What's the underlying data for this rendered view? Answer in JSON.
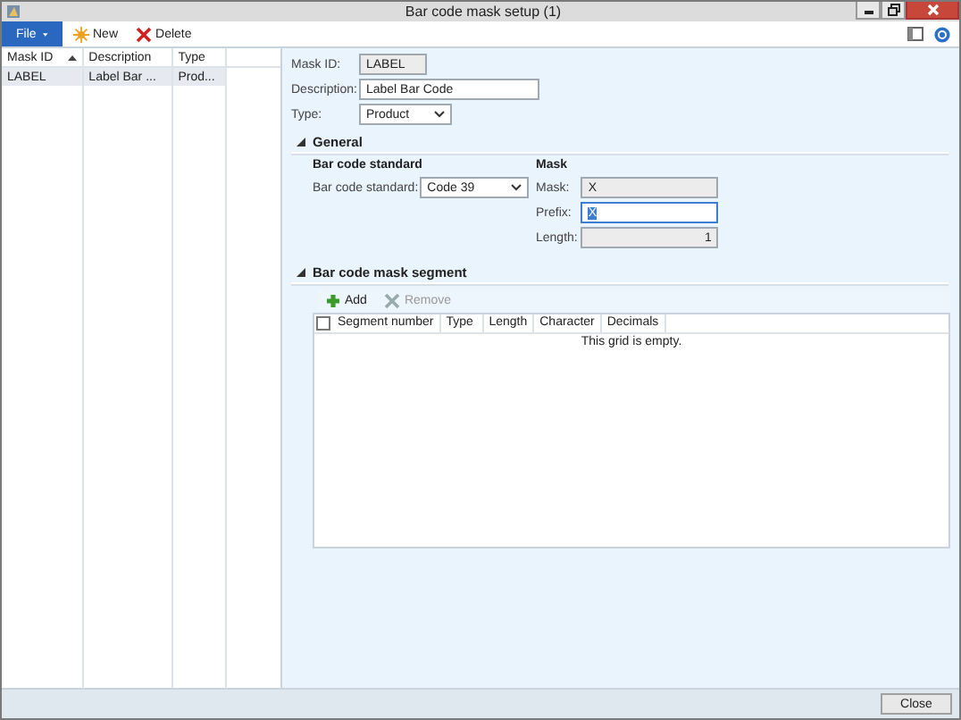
{
  "window": {
    "title": "Bar code mask setup (1)"
  },
  "toolbar": {
    "file_menu": "File",
    "buttons": [
      {
        "kind": "new",
        "label": "New"
      },
      {
        "kind": "delete",
        "label": "Delete"
      }
    ]
  },
  "list": {
    "columns": [
      {
        "label": "Mask ID",
        "sorted": true
      },
      {
        "label": "Description",
        "sorted": false
      },
      {
        "label": "Type",
        "sorted": false
      }
    ],
    "rows": [
      {
        "cells": [
          "LABEL",
          "Label Bar ...",
          "Prod..."
        ],
        "selected": true
      }
    ]
  },
  "header_fields": [
    {
      "label": "Mask ID:",
      "value": "LABEL",
      "kind": "readonly"
    },
    {
      "label": "Description:",
      "value": "Label Bar Code",
      "kind": "text"
    },
    {
      "label": "Type:",
      "value": "Product",
      "kind": "dropdown"
    }
  ],
  "general": {
    "title": "General",
    "expanded": true,
    "groups": [
      {
        "title": "Bar code standard",
        "fields": [
          {
            "label": "Bar code standard:",
            "value": "Code 39",
            "kind": "dropdown"
          }
        ]
      },
      {
        "title": "Mask",
        "fields": [
          {
            "label": "Mask:",
            "value": "X",
            "kind": "readonly"
          },
          {
            "label": "Prefix:",
            "value": "X",
            "kind": "focused"
          },
          {
            "label": "Length:",
            "value": "1",
            "kind": "number"
          }
        ]
      }
    ]
  },
  "segment": {
    "title": "Bar code mask segment",
    "expanded": true,
    "buttons": [
      {
        "kind": "add",
        "label": "Add",
        "disabled": false
      },
      {
        "kind": "remove",
        "label": "Remove",
        "disabled": true
      }
    ],
    "columns": [
      "Segment number",
      "Type",
      "Length",
      "Character",
      "Decimals"
    ],
    "select_all": false,
    "empty_message": "This grid is empty."
  },
  "footer": {
    "buttons": [
      "Close"
    ]
  }
}
